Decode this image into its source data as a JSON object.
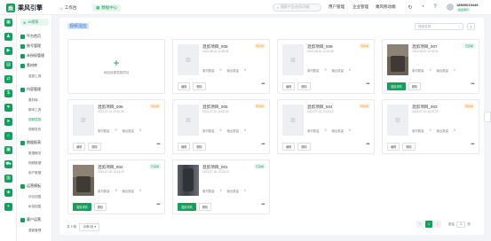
{
  "app": {
    "brand": "乘风引擎",
    "brand_mark": "乘"
  },
  "colors": {
    "primary": "#11a15b",
    "todo": "#e59a2a"
  },
  "topnav": {
    "tabs": [
      {
        "label": "工作台"
      },
      {
        "label": "数据中心"
      }
    ],
    "search_placeholder": "搜索产品/应用/功能",
    "menus": [
      "用户管理",
      "企业管理",
      "乘风移动端"
    ],
    "icons": [
      "refresh-icon",
      "notification-icon",
      "help-icon"
    ],
    "user": {
      "phone": "18800019449",
      "badge": "企业用户"
    }
  },
  "rail": {
    "icons": [
      "grid-icon",
      "users-icon",
      "play-icon",
      "doc-icon",
      "share-icon",
      "dollar-icon",
      "heart-icon",
      "send-icon",
      "home-icon",
      "shop-icon",
      "cart-icon",
      "book-icon",
      "layers-icon",
      "plus-icon"
    ]
  },
  "sidebar": {
    "top_item": "AI视频",
    "groups": [
      {
        "label": "平台首页",
        "items": []
      },
      {
        "label": "账号管理",
        "items": []
      },
      {
        "label": "未授权管理",
        "items": []
      },
      {
        "label": "素材库",
        "items": [
          "混剪工具"
        ]
      },
      {
        "label": "内容管理",
        "items": [
          "素材库",
          "脚本工具",
          "视频混剪",
          "视频发布"
        ]
      },
      {
        "label": "数据报表",
        "items": [
          "数据概览",
          "视频数据",
          "用户数据"
        ]
      },
      {
        "label": "运营模板",
        "items": [
          "评论回复",
          "私信回复"
        ]
      },
      {
        "label": "客户运营",
        "items": [
          "潜客管理"
        ]
      }
    ]
  },
  "main": {
    "page_title": "视频混剪",
    "search_placeholder": "搜索名称",
    "add_card_label": "添加创建混剪项目",
    "status_labels": {
      "todo": "待完成",
      "done": "已完成"
    },
    "stats_labels": {
      "material": "素材数量",
      "output": "输出数量"
    },
    "action_labels": {
      "edit": "编辑",
      "generate": "混剪详情",
      "delete": "删除"
    },
    "cards": [
      {
        "title": "混剪项目_008",
        "date": "2023-08-02 11:38:49",
        "status": "待完成",
        "material": "0",
        "output": "0",
        "thumb": "placeholder"
      },
      {
        "title": "混剪项目_009",
        "date": "2023-08-02 10:20:58",
        "status": "待完成",
        "material": "0",
        "output": "0",
        "thumb": "placeholder"
      },
      {
        "title": "混剪项目_007",
        "date": "2023-08-01 19:18:31",
        "status": "已完成",
        "material": "2",
        "output": "1",
        "thumb": "photo-a"
      },
      {
        "title": "混剪项目_006",
        "date": "2023-07-31 10:01:35",
        "status": "待完成",
        "material": "0",
        "output": "0",
        "thumb": "placeholder"
      },
      {
        "title": "混剪项目_005",
        "date": "2023-07-31 10:02:04",
        "status": "待完成",
        "material": "0",
        "output": "0",
        "thumb": "placeholder"
      },
      {
        "title": "混剪项目_004",
        "date": "2023-07-31 10:02:12",
        "status": "待完成",
        "material": "0",
        "output": "0",
        "thumb": "placeholder"
      },
      {
        "title": "混剪项目_003",
        "date": "2023-07-31 10:02:22",
        "status": "待完成",
        "material": "0",
        "output": "0",
        "thumb": "placeholder"
      },
      {
        "title": "混剪项目_002",
        "date": "2023-07-26 19:13:25",
        "status": "已完成",
        "material": "5",
        "output": "2",
        "thumb": "photo-b"
      },
      {
        "title": "混剪项目_001",
        "date": "2023-07-26 19:13:23",
        "status": "已完成",
        "material": "1",
        "output": "1",
        "thumb": "photo-c"
      }
    ]
  },
  "pagination": {
    "total_label": "共 9 条",
    "page_size": "15条/页",
    "current_page": "1",
    "goto_label": "前往",
    "goto_value": "1",
    "page_suffix": "页"
  }
}
